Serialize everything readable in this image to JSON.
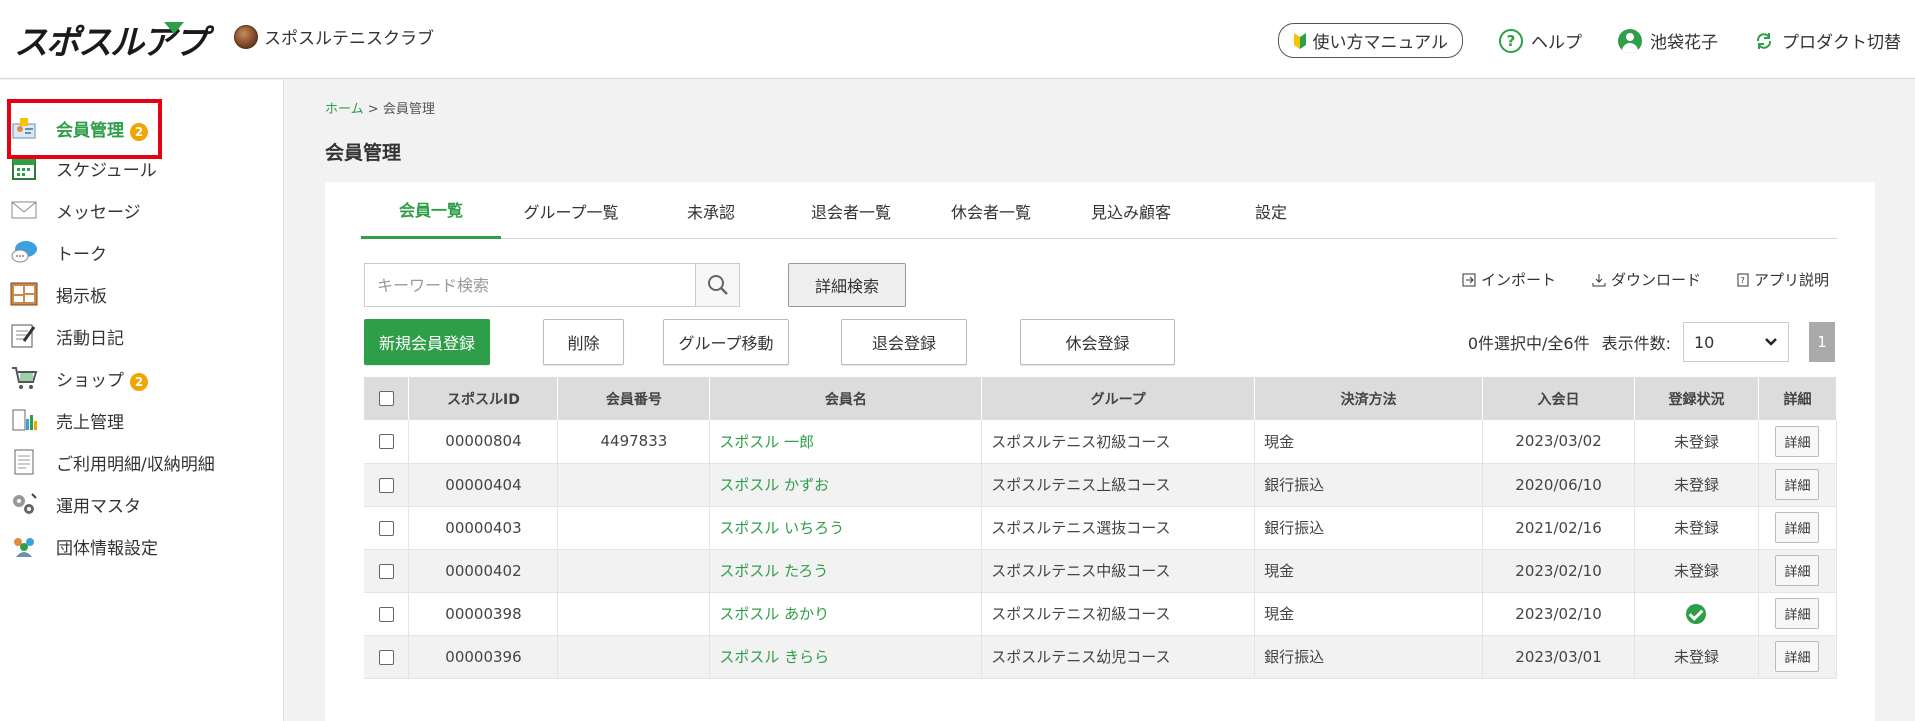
{
  "header": {
    "app_logo": "スポスルアプリ",
    "org_name": "スポスルテニスクラブ",
    "manual_label": "使い方マニュアル",
    "help_label": "ヘルプ",
    "user_name": "池袋花子",
    "product_switch_label": "プロダクト切替"
  },
  "sidebar": {
    "items": [
      {
        "label": "会員管理",
        "icon": "members-icon",
        "badge": "2",
        "active": true
      },
      {
        "label": "スケジュール",
        "icon": "calendar-icon"
      },
      {
        "label": "メッセージ",
        "icon": "mail-icon"
      },
      {
        "label": "トーク",
        "icon": "chat-icon"
      },
      {
        "label": "掲示板",
        "icon": "board-icon"
      },
      {
        "label": "活動日記",
        "icon": "diary-icon"
      },
      {
        "label": "ショップ",
        "icon": "shop-icon",
        "badge": "2"
      },
      {
        "label": "売上管理",
        "icon": "sales-icon"
      },
      {
        "label": "ご利用明細/収納明細",
        "icon": "statement-icon"
      },
      {
        "label": "運用マスタ",
        "icon": "gears-icon"
      },
      {
        "label": "団体情報設定",
        "icon": "group-icon"
      }
    ]
  },
  "breadcrumb": {
    "home": "ホーム",
    "separator": ">",
    "current": "会員管理"
  },
  "page_title": "会員管理",
  "tabs": [
    "会員一覧",
    "グループ一覧",
    "未承認",
    "退会者一覧",
    "休会者一覧",
    "見込み顧客",
    "設定"
  ],
  "search": {
    "placeholder": "キーワード検索",
    "advanced_label": "詳細検索"
  },
  "util_links": {
    "import": "インポート",
    "download": "ダウンロード",
    "app_help": "アプリ説明"
  },
  "actions": {
    "new_member": "新規会員登録",
    "delete": "削除",
    "group_move": "グループ移動",
    "withdraw": "退会登録",
    "suspend": "休会登録"
  },
  "selection_status": "0件選択中/全6件",
  "per_page_label": "表示件数:",
  "per_page_value": "10",
  "page_number": "1",
  "table": {
    "headers": [
      "スポスルID",
      "会員番号",
      "会員名",
      "グループ",
      "決済方法",
      "入会日",
      "登録状況",
      "詳細"
    ],
    "detail_label": "詳細",
    "rows": [
      {
        "id": "00000804",
        "number": "4497833",
        "name": "スポスル 一郎",
        "group": "スポスルテニス初級コース",
        "payment": "現金",
        "joined": "2023/03/02",
        "status": "未登録"
      },
      {
        "id": "00000404",
        "number": "",
        "name": "スポスル かずお",
        "group": "スポスルテニス上級コース",
        "payment": "銀行振込",
        "joined": "2020/06/10",
        "status": "未登録"
      },
      {
        "id": "00000403",
        "number": "",
        "name": "スポスル いちろう",
        "group": "スポスルテニス選抜コース",
        "payment": "銀行振込",
        "joined": "2021/02/16",
        "status": "未登録"
      },
      {
        "id": "00000402",
        "number": "",
        "name": "スポスル たろう",
        "group": "スポスルテニス中級コース",
        "payment": "現金",
        "joined": "2023/02/10",
        "status": "未登録"
      },
      {
        "id": "00000398",
        "number": "",
        "name": "スポスル あかり",
        "group": "スポスルテニス初級コース",
        "payment": "現金",
        "joined": "2023/02/10",
        "status": "registered-check-icon"
      },
      {
        "id": "00000396",
        "number": "",
        "name": "スポスル きらら",
        "group": "スポスルテニス幼児コース",
        "payment": "銀行振込",
        "joined": "2023/03/01",
        "status": "未登録"
      }
    ]
  },
  "colors": {
    "accent": "#2f9e48",
    "badge": "#f0a500",
    "highlight": "#e60012"
  }
}
